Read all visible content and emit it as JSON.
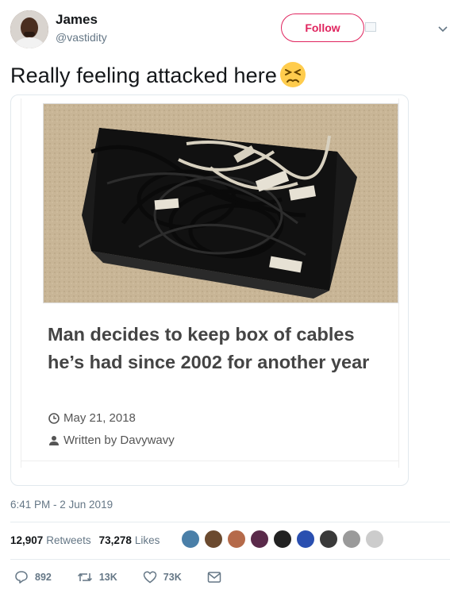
{
  "author": {
    "name": "James",
    "handle": "@vastidity",
    "follow_label": "Follow"
  },
  "tweet": {
    "text": "Really feeling attacked here",
    "emoji": "persevering-face-emoji"
  },
  "card": {
    "image": "box-of-cables-photo",
    "headline": "Man decides to keep box of cables he’s had since 2002 for another year",
    "date": "May 21, 2018",
    "author": "Written by Davywavy"
  },
  "timestamp": "6:41 PM - 2 Jun 2019",
  "stats": {
    "retweets_count": "12,907",
    "retweets_label": "Retweets",
    "likes_count": "73,278",
    "likes_label": "Likes"
  },
  "likers": [
    "#4a7fa8",
    "#6b4a2f",
    "#b56a4a",
    "#5a2a4a",
    "#222222",
    "#2a4fb0",
    "#3a3a3a",
    "#9a9a9a",
    "#cccccc"
  ],
  "actions": {
    "reply_count": "892",
    "retweet_count": "13K",
    "like_count": "73K"
  },
  "colors": {
    "accent": "#e0245e",
    "muted": "#657786"
  }
}
